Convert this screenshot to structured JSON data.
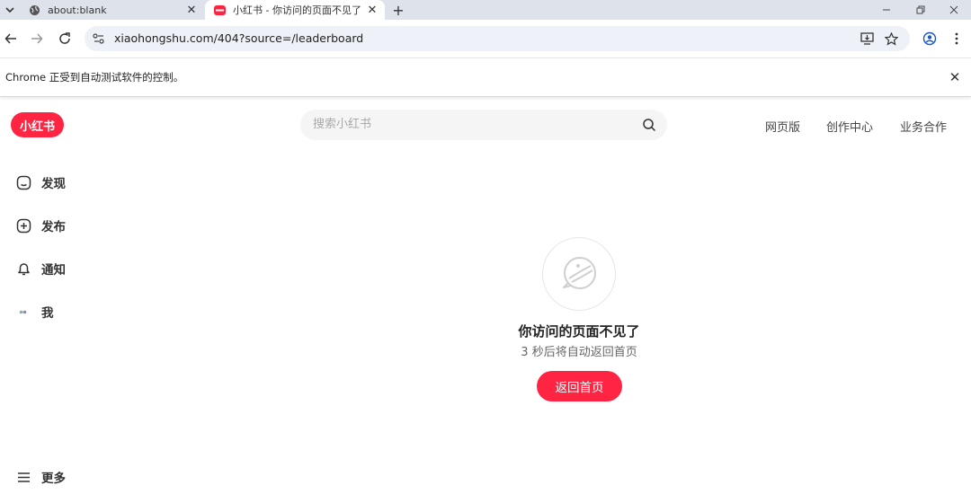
{
  "browser": {
    "tabs": [
      {
        "title": "about:blank",
        "icon": "globe-icon",
        "active": false
      },
      {
        "title": "小红书 - 你访问的页面不见了",
        "icon": "xhs-favicon",
        "active": true
      }
    ],
    "new_tab_label": "+",
    "address_bar": {
      "url": "xiaohongshu.com/404?source=/leaderboard"
    },
    "infobar": {
      "message": "Chrome 正受到自动测试软件的控制。"
    }
  },
  "page": {
    "logo": "小红书",
    "search": {
      "placeholder": "搜索小红书"
    },
    "top_nav": [
      "网页版",
      "创作中心",
      "业务合作"
    ],
    "sidebar": {
      "items": [
        {
          "label": "发现",
          "icon": "home-icon"
        },
        {
          "label": "发布",
          "icon": "plus-square-icon"
        },
        {
          "label": "通知",
          "icon": "bell-icon"
        },
        {
          "label": "我",
          "icon": "avatar-icon"
        }
      ],
      "more_label": "更多"
    },
    "error": {
      "title": "你访问的页面不见了",
      "subtitle": "3 秒后将自动返回首页",
      "button": "返回首页"
    }
  },
  "colors": {
    "brand": "#ff2442",
    "tabbar": "#dee3eb",
    "omnibox": "#eef1f7"
  }
}
